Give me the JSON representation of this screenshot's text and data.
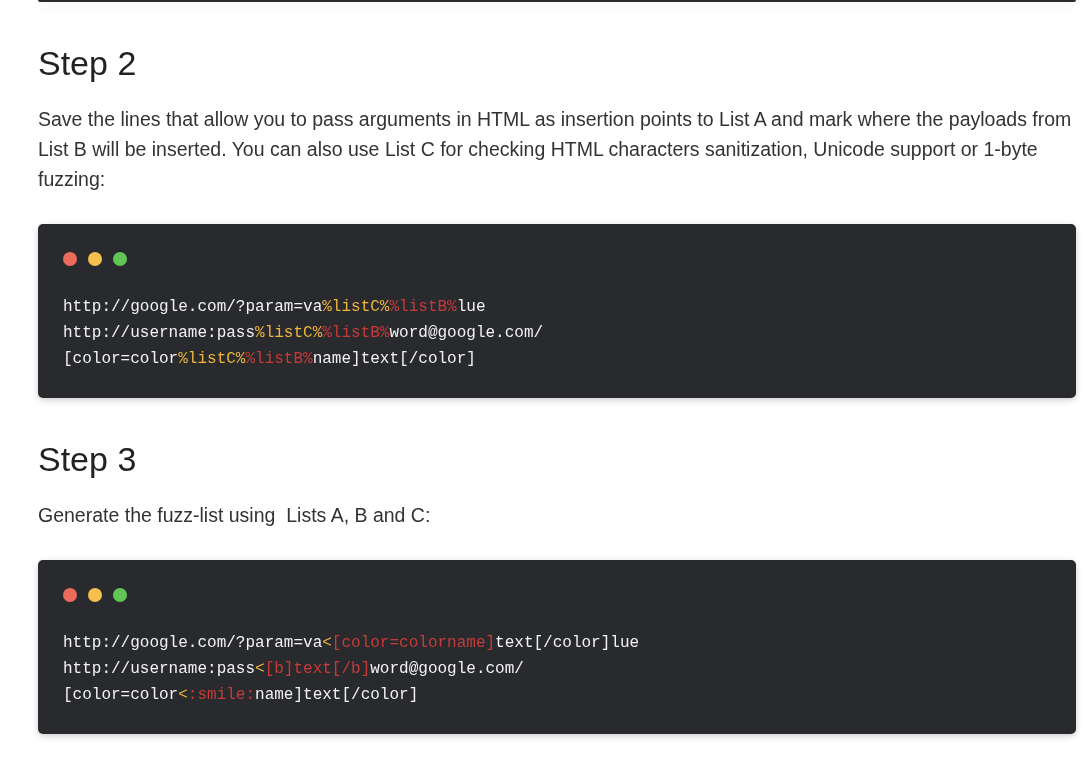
{
  "steps": [
    {
      "heading": "Step 2",
      "text": "Save the lines that allow you to pass arguments in HTML as insertion points to List A and mark where the payloads from List B will be inserted. You can also use List C for checking HTML characters sanitization, Unicode support or 1-byte fuzzing:",
      "code": {
        "window_dots": [
          {
            "color": "#ed6a5e"
          },
          {
            "color": "#f5bf4f"
          },
          {
            "color": "#61c554"
          }
        ],
        "lines": [
          {
            "segments": [
              {
                "text": "http://google.com/?param=va",
                "color": "#f2f2f2"
              },
              {
                "text": "%listC%",
                "color": "#f0b53c"
              },
              {
                "text": "%listB%",
                "color": "#c83a37"
              },
              {
                "text": "lue",
                "color": "#f2f2f2"
              }
            ]
          },
          {
            "segments": [
              {
                "text": "http://username:pass",
                "color": "#f2f2f2"
              },
              {
                "text": "%listC%",
                "color": "#f0b53c"
              },
              {
                "text": "%listB%",
                "color": "#c83a37"
              },
              {
                "text": "word@google.com/",
                "color": "#f2f2f2"
              }
            ]
          },
          {
            "segments": [
              {
                "text": "[color=color",
                "color": "#f2f2f2"
              },
              {
                "text": "%listC%",
                "color": "#f0b53c"
              },
              {
                "text": "%listB%",
                "color": "#c83a37"
              },
              {
                "text": "name]text[/color]",
                "color": "#f2f2f2"
              }
            ]
          }
        ]
      }
    },
    {
      "heading": "Step 3",
      "text": "Generate the fuzz-list using  Lists A, B and C:",
      "code": {
        "window_dots": [
          {
            "color": "#ed6a5e"
          },
          {
            "color": "#f5bf4f"
          },
          {
            "color": "#61c554"
          }
        ],
        "lines": [
          {
            "segments": [
              {
                "text": "http://google.com/?param=va",
                "color": "#f2f2f2"
              },
              {
                "text": "<",
                "color": "#f0b53c"
              },
              {
                "text": "[color=colorname]",
                "color": "#c83a37"
              },
              {
                "text": "text[/color]lue",
                "color": "#f2f2f2"
              }
            ]
          },
          {
            "segments": [
              {
                "text": "http://username:pass",
                "color": "#f2f2f2"
              },
              {
                "text": "<",
                "color": "#f0b53c"
              },
              {
                "text": "[b]text[/b]",
                "color": "#c83a37"
              },
              {
                "text": "word@google.com/",
                "color": "#f2f2f2"
              }
            ]
          },
          {
            "segments": [
              {
                "text": "[color=color",
                "color": "#f2f2f2"
              },
              {
                "text": "<",
                "color": "#f0b53c"
              },
              {
                "text": ":smile:",
                "color": "#c83a37"
              },
              {
                "text": "name]text[/color]",
                "color": "#f2f2f2"
              }
            ]
          }
        ]
      }
    }
  ]
}
